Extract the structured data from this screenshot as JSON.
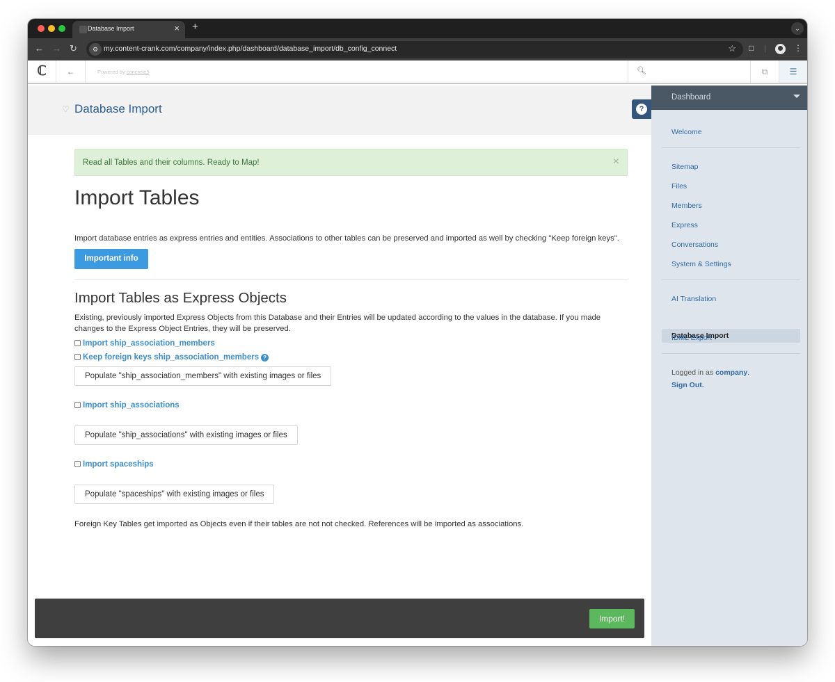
{
  "browser": {
    "tab_title": "Database Import",
    "tab_close": "×",
    "new_tab": "+",
    "url": "my.content-crank.com/company/index.php/dashboard/database_import/db_config_connect"
  },
  "cms": {
    "powered_prefix": "Powered by",
    "powered_link": "concrete5"
  },
  "page": {
    "title": "Database Import",
    "alert": "Read all Tables and their columns. Ready to Map!",
    "alert_close": "×",
    "heading": "Import Tables",
    "intro": "Import database entries as express entries and entities. Associations to other tables can be preserved and imported as well by checking \"Keep foreign keys\".",
    "info_button": "Important info",
    "subheading": "Import Tables as Express Objects",
    "description": "Existing, previously imported Express Objects from this Database and their Entries will be updated according to the values in the database. If you made changes to the Express Object Entries, they will be preserved.",
    "tables": [
      {
        "import_label": "Import ship_association_members",
        "foreign_label": "Keep foreign keys ship_association_members",
        "populate_label": "Populate \"ship_association_members\" with existing images or files"
      },
      {
        "import_label": "Import ship_associations",
        "populate_label": "Populate \"ship_associations\" with existing images or files"
      },
      {
        "import_label": "Import spaceships",
        "populate_label": "Populate \"spaceships\" with existing images or files"
      }
    ],
    "footnote": "Foreign Key Tables get imported as Objects even if their tables are not not checked. References will be imported as associations.",
    "import_button": "Import!"
  },
  "sidebar": {
    "header": "Dashboard",
    "items": [
      "Welcome",
      "Sitemap",
      "Files",
      "Members",
      "Express",
      "Conversations",
      "System & Settings",
      "AI Translation",
      "Database Import",
      "IDML Export"
    ],
    "logged_in_prefix": "Logged in as",
    "user": "company",
    "sign_out": "Sign Out."
  },
  "colors": {
    "accent": "#3c9ae0",
    "success": "#5cb85c",
    "alert_bg": "#dff0d8",
    "sidebar_header": "#4a5866"
  }
}
